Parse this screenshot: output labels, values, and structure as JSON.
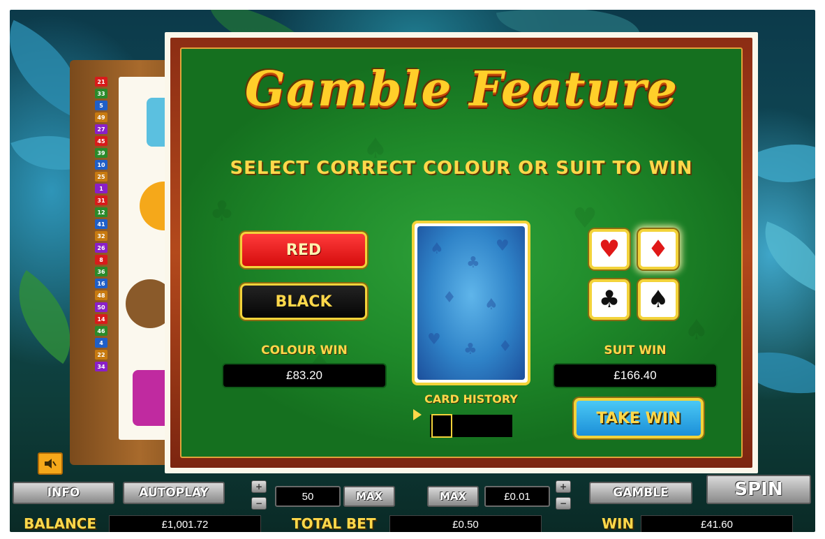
{
  "modal": {
    "title": "Gamble Feature",
    "subtitle": "SELECT CORRECT COLOUR OR SUIT TO WIN",
    "red_label": "RED",
    "black_label": "BLACK",
    "colour_win_label": "COLOUR WIN",
    "colour_win_value": "£83.20",
    "suit_win_label": "SUIT WIN",
    "suit_win_value": "£166.40",
    "card_history_label": "CARD HISTORY",
    "take_win_label": "TAKE WIN",
    "suits": [
      {
        "name": "hearts",
        "glyph": "♥",
        "icon": "heart-icon"
      },
      {
        "name": "diamonds",
        "glyph": "♦",
        "icon": "diamond-icon"
      },
      {
        "name": "clubs",
        "glyph": "♣",
        "icon": "club-icon"
      },
      {
        "name": "spades",
        "glyph": "♠",
        "icon": "spade-icon"
      }
    ]
  },
  "paylines": [
    "21",
    "33",
    "5",
    "49",
    "27",
    "45",
    "39",
    "10",
    "25",
    "1",
    "31",
    "12",
    "41",
    "32",
    "26",
    "8",
    "36",
    "16",
    "48",
    "50",
    "14",
    "46",
    "4",
    "22",
    "34"
  ],
  "controls": {
    "info_label": "INFO",
    "autoplay_label": "AUTOPLAY",
    "lines_value": "50",
    "max_label": "MAX",
    "bet_max_label": "MAX",
    "bet_value": "£0.01",
    "gamble_label": "GAMBLE",
    "spin_label": "SPIN",
    "plus_glyph": "+",
    "minus_glyph": "−"
  },
  "footer": {
    "balance_label": "BALANCE",
    "balance_value": "£1,001.72",
    "total_bet_label": "TOTAL BET",
    "total_bet_value": "£0.50",
    "win_label": "WIN",
    "win_value": "£41.60"
  },
  "colors": {
    "gold": "#ffd84a",
    "felt_green": "#1f8a2a",
    "red_button": "#e01818",
    "take_win_blue": "#1c8fd8"
  }
}
